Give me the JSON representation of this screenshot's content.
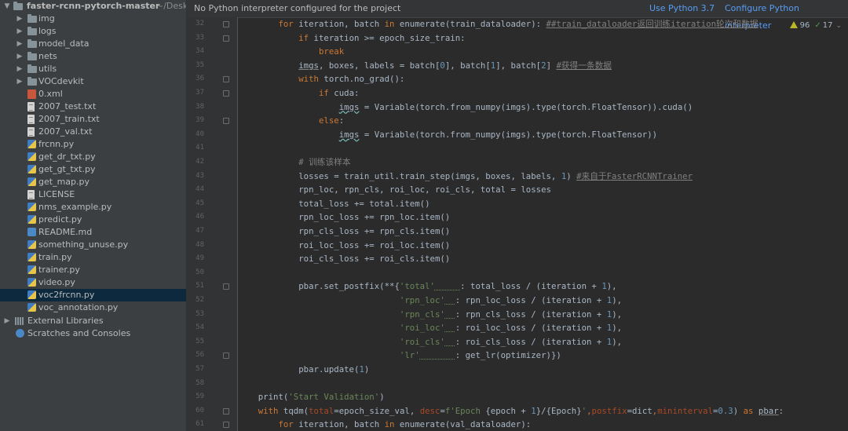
{
  "project": {
    "root": {
      "name": "faster-rcnn-pytorch-master",
      "path": "~/Desk"
    },
    "items": [
      {
        "label": "img",
        "type": "folder"
      },
      {
        "label": "logs",
        "type": "folder"
      },
      {
        "label": "model_data",
        "type": "folder"
      },
      {
        "label": "nets",
        "type": "folder"
      },
      {
        "label": "utils",
        "type": "folder"
      },
      {
        "label": "VOCdevkit",
        "type": "folder"
      },
      {
        "label": "0.xml",
        "type": "xml"
      },
      {
        "label": "2007_test.txt",
        "type": "txt"
      },
      {
        "label": "2007_train.txt",
        "type": "txt"
      },
      {
        "label": "2007_val.txt",
        "type": "txt"
      },
      {
        "label": "frcnn.py",
        "type": "py"
      },
      {
        "label": "get_dr_txt.py",
        "type": "py"
      },
      {
        "label": "get_gt_txt.py",
        "type": "py"
      },
      {
        "label": "get_map.py",
        "type": "py"
      },
      {
        "label": "LICENSE",
        "type": "txt"
      },
      {
        "label": "nms_example.py",
        "type": "py"
      },
      {
        "label": "predict.py",
        "type": "py"
      },
      {
        "label": "README.md",
        "type": "md"
      },
      {
        "label": "something_unuse.py",
        "type": "py"
      },
      {
        "label": "train.py",
        "type": "py"
      },
      {
        "label": "trainer.py",
        "type": "py"
      },
      {
        "label": "video.py",
        "type": "py"
      },
      {
        "label": "voc2frcnn.py",
        "type": "py",
        "selected": true
      },
      {
        "label": "voc_annotation.py",
        "type": "py"
      }
    ],
    "external_libraries": "External Libraries",
    "scratches": "Scratches and Consoles"
  },
  "banner": {
    "message": "No Python interpreter configured for the project",
    "use_python": "Use Python 3.7",
    "configure": "Configure Python interpreter"
  },
  "inspection": {
    "warnings": "96",
    "ok": "17"
  },
  "editor": {
    "lines": [
      {
        "n": "32",
        "fold": true,
        "tokens": [
          [
            "        ",
            ""
          ],
          [
            "for",
            "kw"
          ],
          [
            " iteration, batch ",
            ""
          ],
          [
            "in",
            "kw"
          ],
          [
            " enumerate(train_dataloader): ",
            ""
          ],
          [
            "##train_dataloader返回训练iteration轮次和数据",
            "cmt under"
          ]
        ]
      },
      {
        "n": "33",
        "fold": true,
        "tokens": [
          [
            "            ",
            ""
          ],
          [
            "if",
            "kw"
          ],
          [
            " iteration >= epoch_size_train:",
            ""
          ]
        ]
      },
      {
        "n": "34",
        "fold": false,
        "tokens": [
          [
            "                ",
            ""
          ],
          [
            "break",
            "kw"
          ]
        ]
      },
      {
        "n": "35",
        "fold": false,
        "tokens": [
          [
            "            ",
            ""
          ],
          [
            "imgs",
            "under"
          ],
          [
            ", boxes, labels = batch[",
            ""
          ],
          [
            "0",
            "num"
          ],
          [
            "], batch[",
            ""
          ],
          [
            "1",
            "num"
          ],
          [
            "], batch[",
            ""
          ],
          [
            "2",
            "num"
          ],
          [
            "] ",
            ""
          ],
          [
            "#获得一条数据",
            "cmt under"
          ]
        ]
      },
      {
        "n": "36",
        "fold": true,
        "tokens": [
          [
            "            ",
            ""
          ],
          [
            "with",
            "kw"
          ],
          [
            " torch.no_grad():",
            ""
          ]
        ]
      },
      {
        "n": "37",
        "fold": true,
        "tokens": [
          [
            "                ",
            ""
          ],
          [
            "if",
            "kw"
          ],
          [
            " cuda:",
            ""
          ]
        ]
      },
      {
        "n": "38",
        "fold": false,
        "tokens": [
          [
            "                    ",
            ""
          ],
          [
            "imgs",
            "wavy"
          ],
          [
            " = Variable(torch.from_numpy(imgs).type(torch.FloatTensor)).cuda()",
            ""
          ]
        ]
      },
      {
        "n": "39",
        "fold": true,
        "tokens": [
          [
            "                ",
            ""
          ],
          [
            "else",
            "kw"
          ],
          [
            ":",
            ""
          ]
        ]
      },
      {
        "n": "40",
        "fold": false,
        "tokens": [
          [
            "                    ",
            ""
          ],
          [
            "imgs",
            "wavy"
          ],
          [
            " = Variable(torch.from_numpy(imgs).type(torch.FloatTensor))",
            ""
          ]
        ]
      },
      {
        "n": "41",
        "fold": false,
        "tokens": []
      },
      {
        "n": "42",
        "fold": false,
        "tokens": [
          [
            "            ",
            ""
          ],
          [
            "# 训练该样本",
            "cmt"
          ]
        ]
      },
      {
        "n": "43",
        "fold": false,
        "tokens": [
          [
            "            losses = train_util.train_step(imgs, boxes, labels, ",
            ""
          ],
          [
            "1",
            "num"
          ],
          [
            ") ",
            ""
          ],
          [
            "#来自于FasterRCNNTrainer",
            "cmt under"
          ]
        ]
      },
      {
        "n": "44",
        "fold": false,
        "tokens": [
          [
            "            rpn_loc, rpn_cls, roi_loc, roi_cls, total = losses",
            ""
          ]
        ]
      },
      {
        "n": "45",
        "fold": false,
        "tokens": [
          [
            "            total_loss += total.item()",
            ""
          ]
        ]
      },
      {
        "n": "46",
        "fold": false,
        "tokens": [
          [
            "            rpn_loc_loss += rpn_loc.item()",
            ""
          ]
        ]
      },
      {
        "n": "47",
        "fold": false,
        "tokens": [
          [
            "            rpn_cls_loss += rpn_cls.item()",
            ""
          ]
        ]
      },
      {
        "n": "48",
        "fold": false,
        "tokens": [
          [
            "            roi_loc_loss += roi_loc.item()",
            ""
          ]
        ]
      },
      {
        "n": "49",
        "fold": false,
        "tokens": [
          [
            "            roi_cls_loss += roi_cls.item()",
            ""
          ]
        ]
      },
      {
        "n": "50",
        "fold": false,
        "tokens": []
      },
      {
        "n": "51",
        "fold": true,
        "tokens": [
          [
            "            pbar.set_postfix(**{",
            ""
          ],
          [
            "'total'",
            "str"
          ],
          [
            "     ",
            "green-u"
          ],
          [
            ": total_loss / (iteration + ",
            ""
          ],
          [
            "1",
            "num"
          ],
          [
            "),",
            ""
          ]
        ]
      },
      {
        "n": "52",
        "fold": false,
        "tokens": [
          [
            "                                ",
            ""
          ],
          [
            "'rpn_loc'",
            "str"
          ],
          [
            "  ",
            "green-u"
          ],
          [
            ": rpn_loc_loss / (iteration + ",
            ""
          ],
          [
            "1",
            "num"
          ],
          [
            "),",
            ""
          ]
        ]
      },
      {
        "n": "53",
        "fold": false,
        "tokens": [
          [
            "                                ",
            ""
          ],
          [
            "'rpn_cls'",
            "str"
          ],
          [
            "  ",
            "green-u"
          ],
          [
            ": rpn_cls_loss / (iteration + ",
            ""
          ],
          [
            "1",
            "num"
          ],
          [
            "),",
            ""
          ]
        ]
      },
      {
        "n": "54",
        "fold": false,
        "tokens": [
          [
            "                                ",
            ""
          ],
          [
            "'roi_loc'",
            "str"
          ],
          [
            "  ",
            "green-u"
          ],
          [
            ": roi_loc_loss / (iteration + ",
            ""
          ],
          [
            "1",
            "num"
          ],
          [
            "),",
            ""
          ]
        ]
      },
      {
        "n": "55",
        "fold": false,
        "tokens": [
          [
            "                                ",
            ""
          ],
          [
            "'roi_cls'",
            "str"
          ],
          [
            "  ",
            "green-u"
          ],
          [
            ": roi_cls_loss / (iteration + ",
            ""
          ],
          [
            "1",
            "num"
          ],
          [
            "),",
            ""
          ]
        ]
      },
      {
        "n": "56",
        "fold": true,
        "tokens": [
          [
            "                                ",
            ""
          ],
          [
            "'lr'",
            "str"
          ],
          [
            "       ",
            "green-u"
          ],
          [
            ": get_lr(optimizer)})",
            ""
          ]
        ]
      },
      {
        "n": "57",
        "fold": false,
        "tokens": [
          [
            "            pbar.update(",
            ""
          ],
          [
            "1",
            "num"
          ],
          [
            ")",
            ""
          ]
        ]
      },
      {
        "n": "58",
        "fold": false,
        "tokens": []
      },
      {
        "n": "59",
        "fold": false,
        "tokens": [
          [
            "    print(",
            ""
          ],
          [
            "'Start Validation'",
            "str"
          ],
          [
            ")",
            ""
          ]
        ]
      },
      {
        "n": "60",
        "fold": true,
        "tokens": [
          [
            "    ",
            ""
          ],
          [
            "with",
            "kw"
          ],
          [
            " tqdm(",
            ""
          ],
          [
            "total",
            "param"
          ],
          [
            "=epoch_size_val, ",
            ""
          ],
          [
            "desc",
            "param"
          ],
          [
            "=",
            ""
          ],
          [
            "f'Epoch ",
            "str"
          ],
          [
            "{epoch + ",
            ""
          ],
          [
            "1",
            "num"
          ],
          [
            "}/{Epoch}",
            ""
          ],
          [
            "'",
            "str"
          ],
          [
            ",",
            "kw"
          ],
          [
            "postfix",
            "param"
          ],
          [
            "=dict",
            ""
          ],
          [
            ",",
            "kw"
          ],
          [
            "mininterval",
            "param"
          ],
          [
            "=",
            ""
          ],
          [
            "0.3",
            "num"
          ],
          [
            ") ",
            ""
          ],
          [
            "as",
            "kw"
          ],
          [
            " ",
            ""
          ],
          [
            "pbar",
            "under"
          ],
          [
            ":",
            ""
          ]
        ]
      },
      {
        "n": "61",
        "fold": true,
        "tokens": [
          [
            "        ",
            ""
          ],
          [
            "for",
            "kw"
          ],
          [
            " iteration, batch ",
            ""
          ],
          [
            "in",
            "kw"
          ],
          [
            " enumerate(val_dataloader):",
            ""
          ]
        ]
      }
    ]
  }
}
